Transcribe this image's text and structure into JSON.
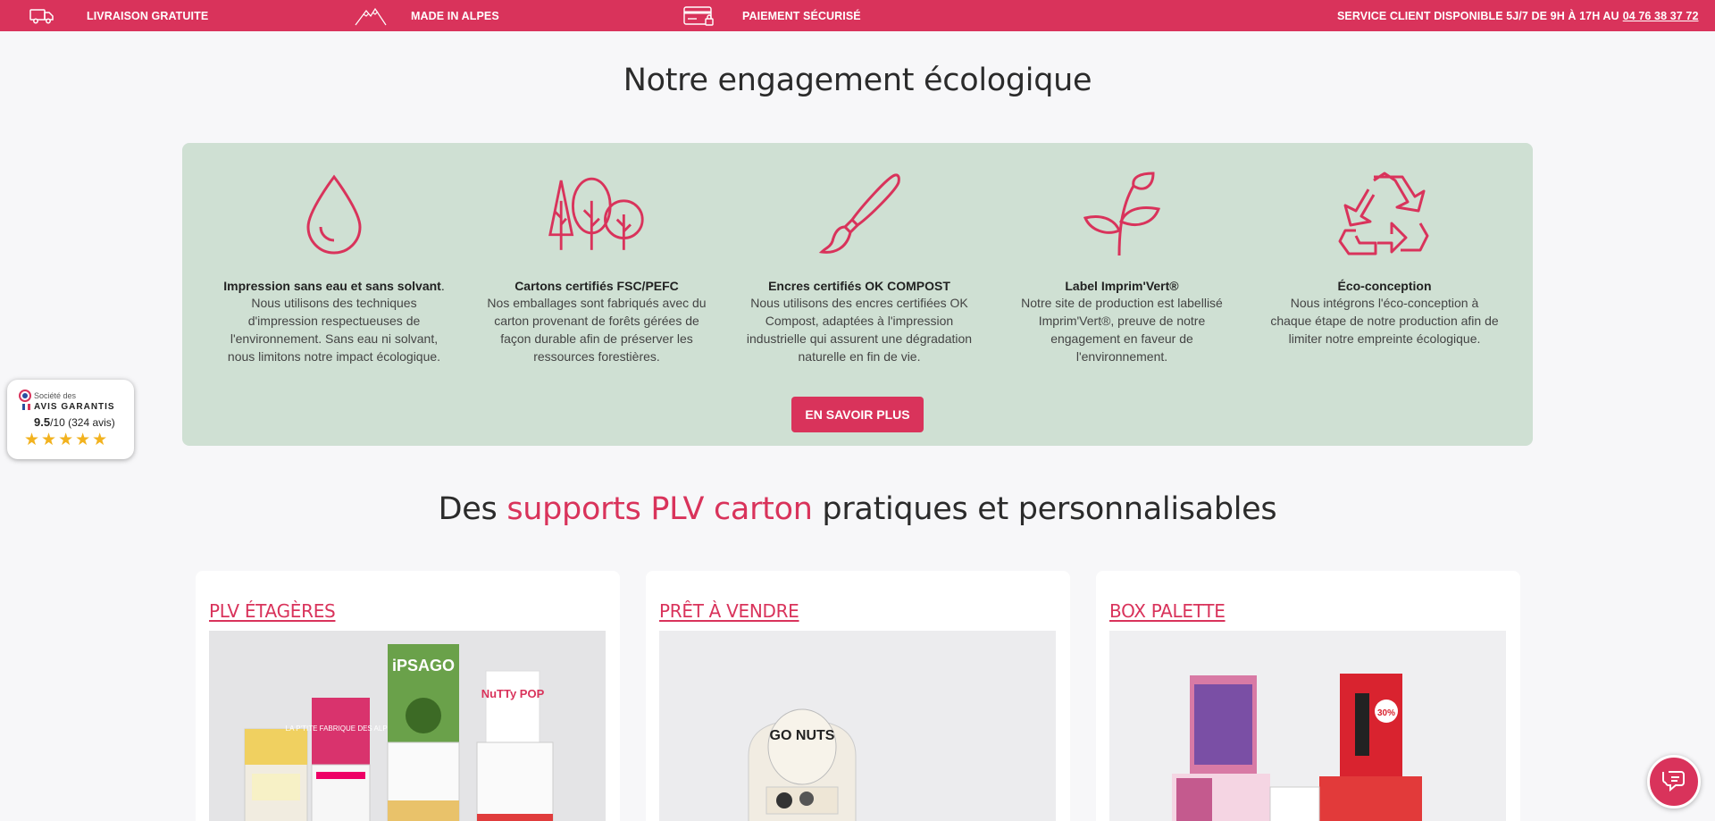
{
  "topbar": {
    "delivery": "LIVRAISON GRATUITE",
    "alps": "MADE IN ALPES",
    "payment": "PAIEMENT SÉCURISÉ",
    "service": "SERVICE CLIENT DISPONIBLE 5J/7 DE 9H À 17H AU",
    "phone": "04 76 38 37 72",
    "icons": [
      "truck-icon",
      "mountain-icon",
      "credit-card-icon"
    ]
  },
  "eco": {
    "title": "Notre engagement écologique",
    "items": [
      {
        "icon": "water-drop-icon",
        "title": "Impression sans eau et sans solvant",
        "title_suffix": ".",
        "desc": "Nous utilisons des techniques d'impression respectueuses de l'environnement. Sans eau ni solvant, nous limitons notre impact écologique."
      },
      {
        "icon": "trees-icon",
        "title": "Cartons certifiés FSC/PEFC",
        "desc": "Nos emballages sont fabriqués avec du carton provenant de forêts gérées de façon durable afin de préserver les ressources forestières."
      },
      {
        "icon": "paintbrush-icon",
        "title": "Encres certifiés OK COMPOST",
        "desc": "Nous utilisons des encres certifiées OK Compost, adaptées à l'impression industrielle qui assurent une dégradation naturelle en fin de vie."
      },
      {
        "icon": "plant-icon",
        "title": "Label Imprim'Vert®",
        "desc": "Notre site de production est labellisé Imprim'Vert®, preuve de notre engagement en faveur de l'environnement."
      },
      {
        "icon": "recycle-icon",
        "title": "Éco-conception",
        "desc": "Nous intégrons l'éco-conception à chaque étape de notre production afin de limiter notre empreinte écologique."
      }
    ],
    "button": "EN SAVOIR PLUS"
  },
  "plv": {
    "title_before": "Des",
    "title_accent": "supports PLV carton",
    "title_after": "pratiques et personnalisables",
    "cards": [
      {
        "title": "PLV ÉTAGÈRES",
        "image_labels": [
          "iPSAGO",
          "NuTTy POP",
          "LA P'TITE FABRIQUE DES ALPES"
        ]
      },
      {
        "title": "PRÊT À VENDRE",
        "image_labels": [
          "GO NUTS"
        ]
      },
      {
        "title": "BOX PALETTE",
        "image_labels": [
          "30%"
        ]
      }
    ]
  },
  "avis": {
    "line1": "Société des",
    "line2": "AVIS GARANTIS",
    "score": "9.5",
    "scale": "/10",
    "count": "(324 avis)",
    "stars": "★★★★★"
  },
  "chat": {
    "icon": "chat-icon"
  },
  "colors": {
    "brand": "#d9335b",
    "panel": "#cfe0d3",
    "background": "#f7f7f9",
    "stars": "#f2b21e"
  }
}
